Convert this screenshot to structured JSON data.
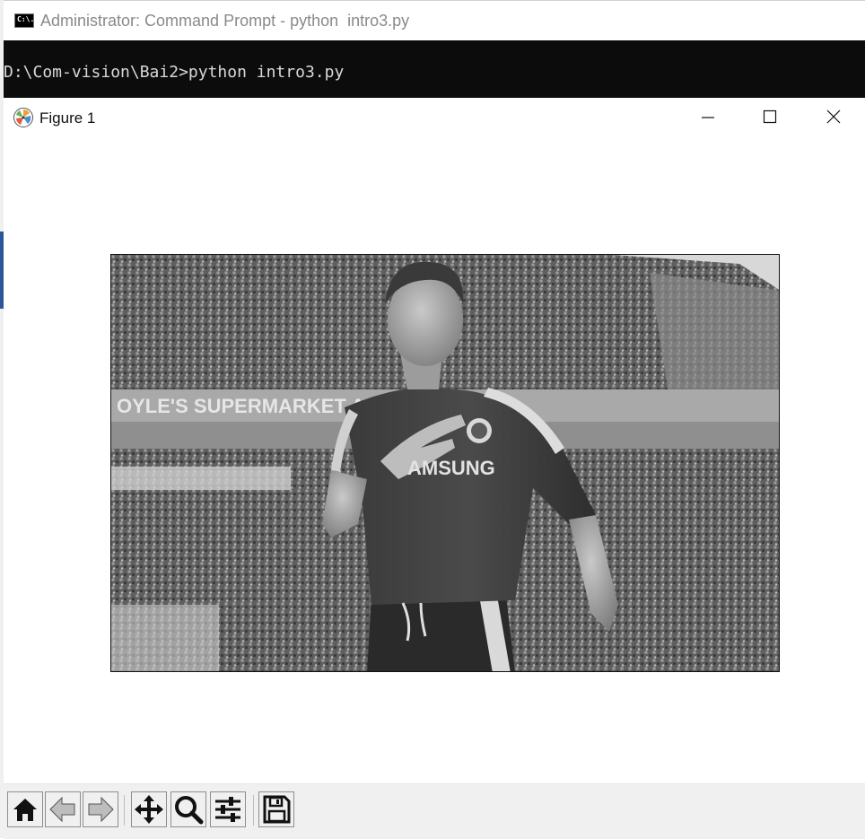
{
  "cmd": {
    "title": "Administrator: Command Prompt - python  intro3.py",
    "icon": "cmd-icon",
    "icon_text": "C:\\.",
    "console_line": "D:\\Com-vision\\Bai2>python intro3.py"
  },
  "figure": {
    "title": "Figure 1",
    "icon": "matplotlib-icon",
    "image": "grayscale-photo-footballer-chelsea-kit",
    "jersey_text": "AMSUNG",
    "banner_text": "OYLE'S SUPERMARKET AR",
    "window_buttons": [
      "minimize-icon",
      "maximize-icon",
      "close-icon"
    ]
  },
  "toolbar": {
    "buttons": [
      "home-icon",
      "back-arrow-icon",
      "forward-arrow-icon",
      "pan-icon",
      "zoom-icon",
      "configure-subplots-icon",
      "save-icon"
    ]
  }
}
